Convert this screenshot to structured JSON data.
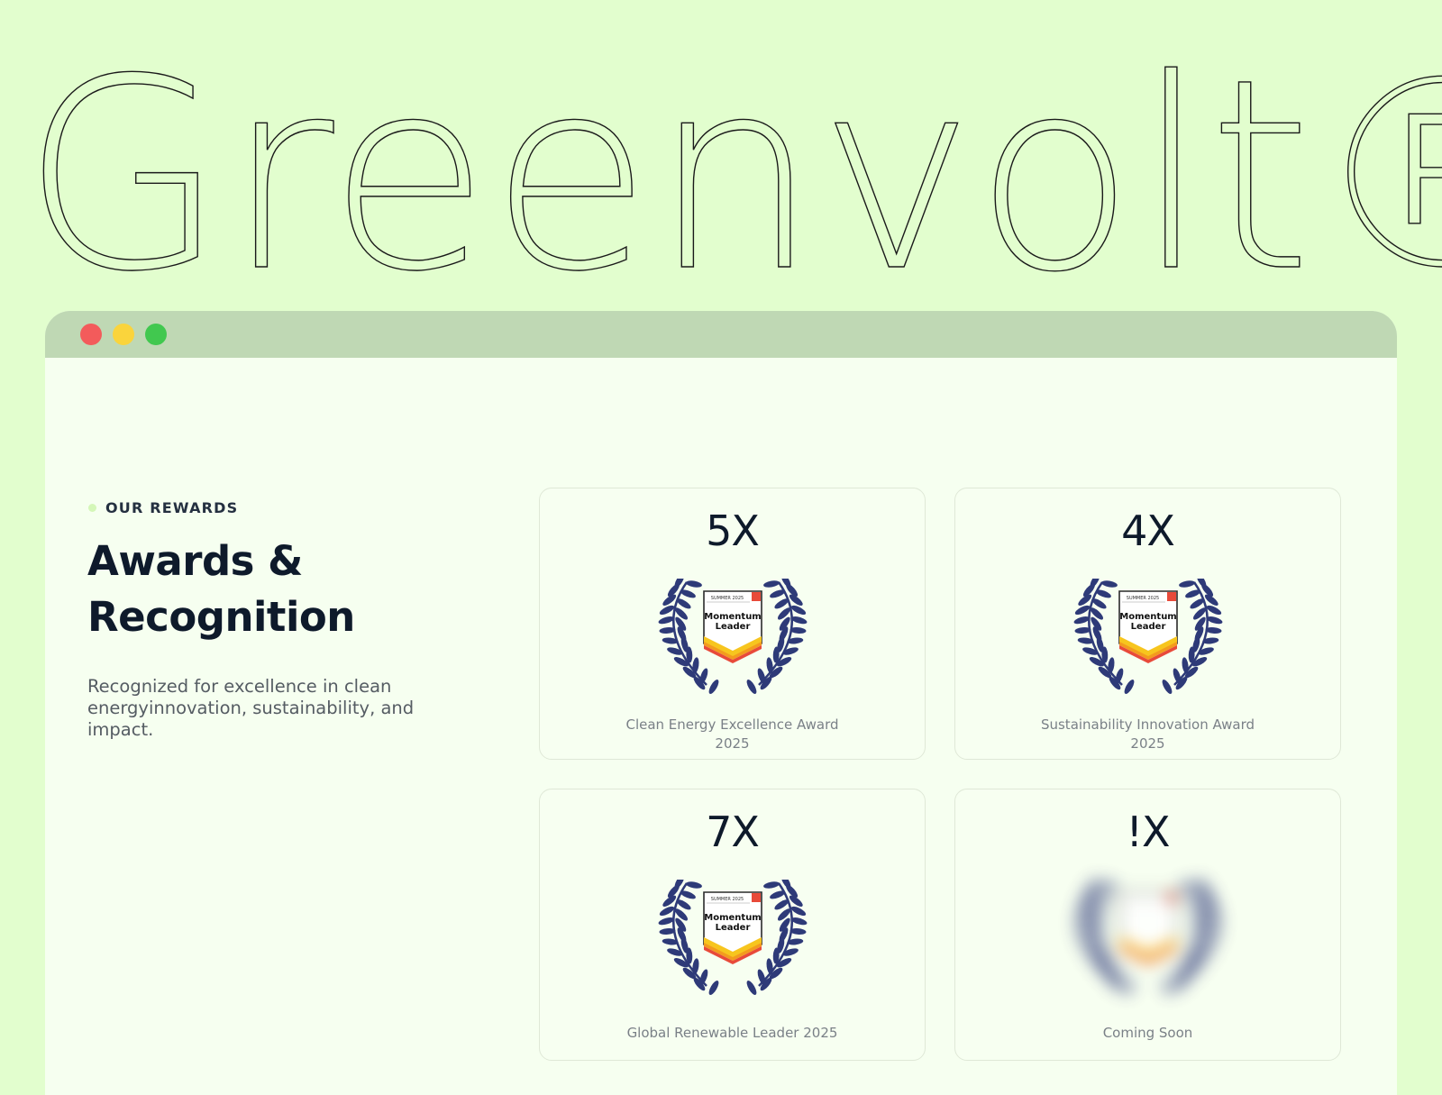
{
  "brand": {
    "wordmark": "Greenvolt®"
  },
  "window": {
    "controls": [
      {
        "name": "close",
        "color": "#f35b5b"
      },
      {
        "name": "minimize",
        "color": "#fad43c"
      },
      {
        "name": "maximize",
        "color": "#41c84f"
      }
    ]
  },
  "section": {
    "eyebrow": "OUR REWARDS",
    "eyebrow_dot_color": "#d4f7b8",
    "title": "Awards & Recognition",
    "description": "Recognized for excellence in clean energyinnovation, sustainability, and impact."
  },
  "awards": [
    {
      "count": "5X",
      "badge": {
        "top": "SUMMER 2025",
        "line1": "Momentum",
        "line2": "Leader",
        "icon": "laurel-badge-icon"
      },
      "caption_line1": "Clean Energy Excellence Award",
      "caption_line2": "2025"
    },
    {
      "count": "4X",
      "badge": {
        "top": "SUMMER 2025",
        "line1": "Momentum",
        "line2": "Leader",
        "icon": "laurel-badge-icon"
      },
      "caption_line1": "Sustainability Innovation Award",
      "caption_line2": "2025"
    },
    {
      "count": "7X",
      "badge": {
        "top": "SUMMER 2025",
        "line1": "Momentum",
        "line2": "Leader",
        "icon": "laurel-badge-icon"
      },
      "caption_line1": "Global Renewable Leader 2025",
      "caption_line2": ""
    },
    {
      "count": "!X",
      "badge": {
        "top": "",
        "line1": "",
        "line2": "",
        "icon": "blurred-laurel-badge-icon"
      },
      "caption_line1": "Coming Soon",
      "caption_line2": ""
    }
  ],
  "colors": {
    "page_bg": "#e2fece",
    "titlebar": "#bfd8b4",
    "laurel": "#2e3a78",
    "badge_red": "#e84a3a",
    "badge_orange": "#f39b1e",
    "badge_yellow": "#f7c51e"
  }
}
